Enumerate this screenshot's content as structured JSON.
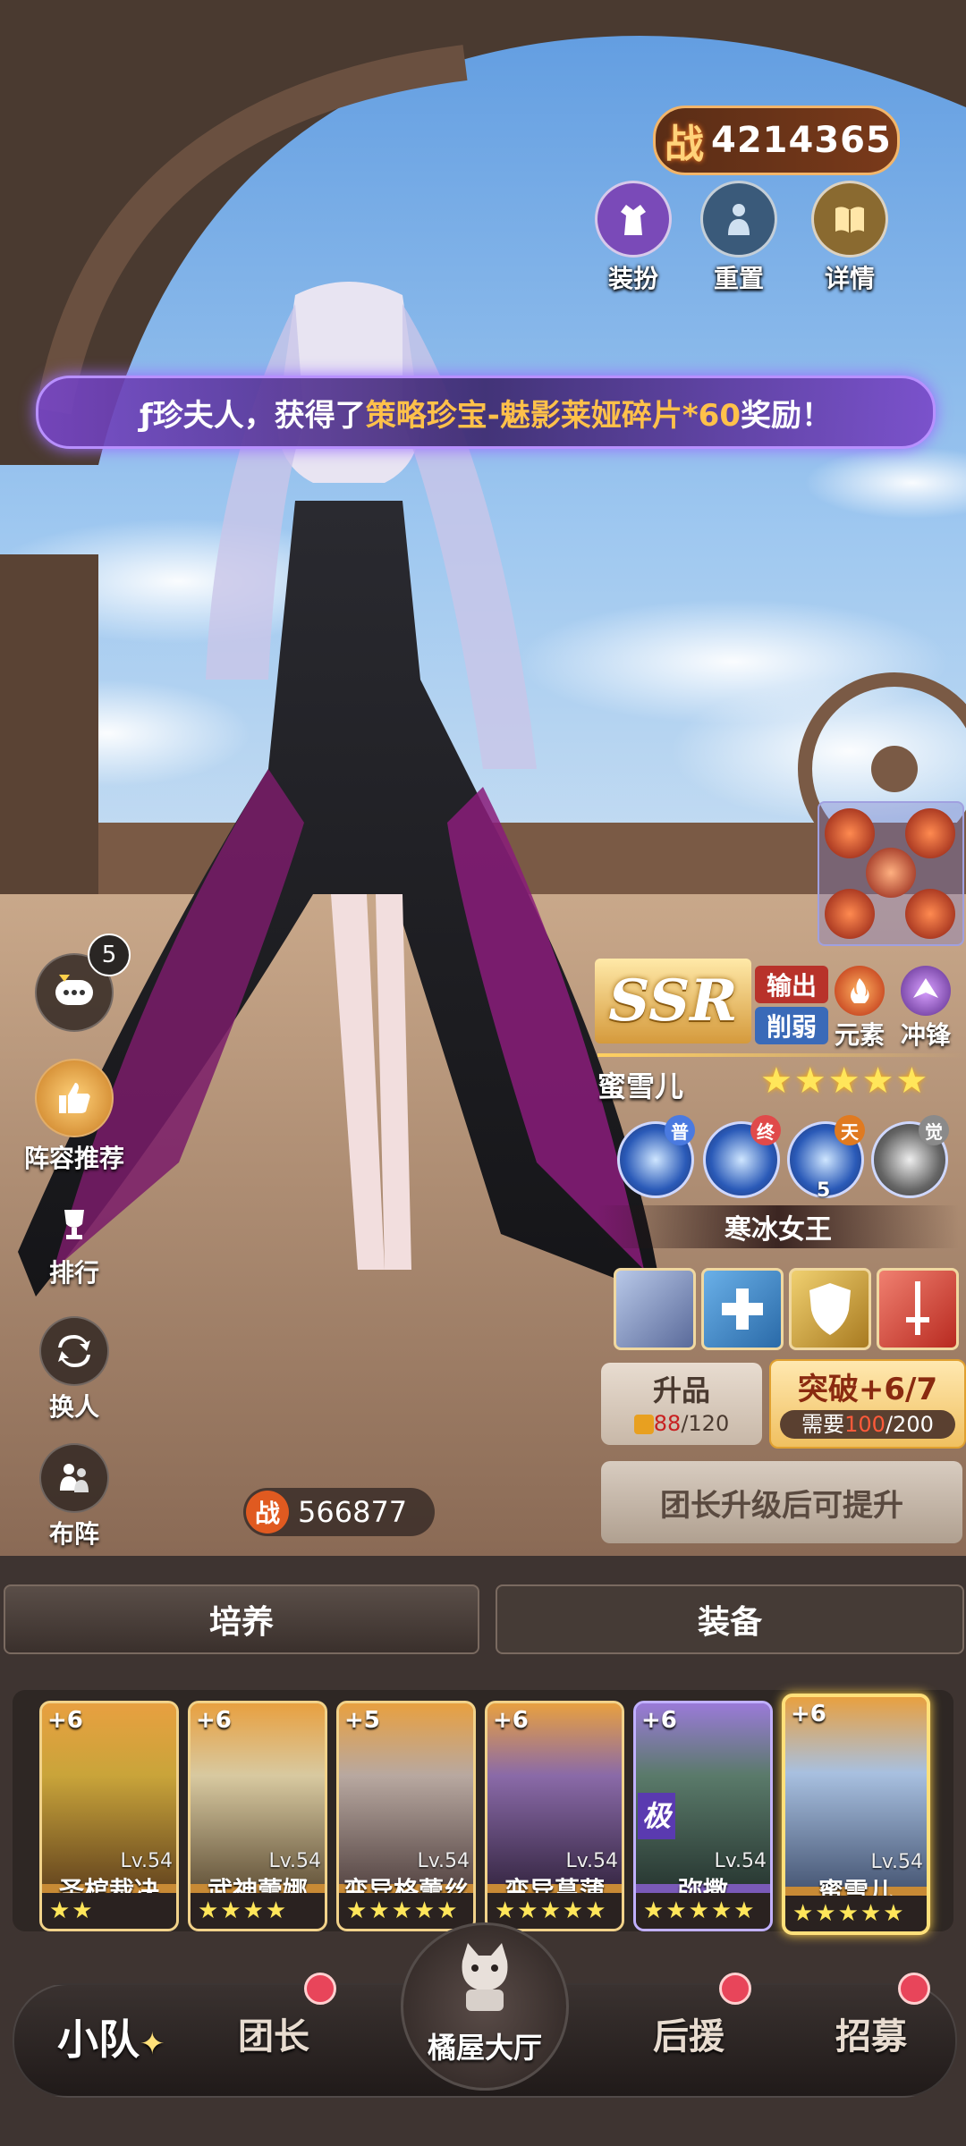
{
  "power": {
    "glyph": "战",
    "total": "4214365"
  },
  "top_buttons": [
    {
      "id": "outfit",
      "label": "装扮",
      "icon": "dress-icon",
      "color": "#7a4ab8"
    },
    {
      "id": "reset",
      "label": "重置",
      "icon": "person-reset-icon",
      "color": "#3a5a7a"
    },
    {
      "id": "details",
      "label": "详情",
      "icon": "book-icon",
      "color": "#8a6a30"
    }
  ],
  "banner": {
    "prefix": "ƒ珍夫人，获得了",
    "highlight": "策略珍宝-魅影莱娅碎片*60",
    "suffix": "奖励！"
  },
  "side_menu": {
    "chat_badge": "5",
    "items": [
      {
        "id": "lineup-recommend",
        "label": "阵容推荐",
        "icon": "thumbs-up-icon"
      },
      {
        "id": "ranking",
        "label": "排行",
        "icon": "trophy-icon"
      },
      {
        "id": "swap",
        "label": "换人",
        "icon": "swap-icon"
      },
      {
        "id": "formation",
        "label": "布阵",
        "icon": "formation-icon"
      }
    ]
  },
  "hero": {
    "rarity": "SSR",
    "role_tags": [
      "输出",
      "削弱"
    ],
    "element_label": "元素",
    "class_label": "冲锋",
    "name": "蜜雪儿",
    "stars": "★★★★★",
    "skills": [
      {
        "tag": "普",
        "tag_color": "#4a7ae0"
      },
      {
        "tag": "终",
        "tag_color": "#e04a4a"
      },
      {
        "tag": "天",
        "tag_color": "#e07a20",
        "level": "5"
      },
      {
        "tag": "觉",
        "tag_color": "#8a8a8a"
      }
    ],
    "title": "寒冰女王",
    "hero_power": "566877"
  },
  "actions": {
    "upgrade": {
      "label": "升品",
      "current": "88",
      "sep": "/",
      "max": "120"
    },
    "breakthrough": {
      "label": "突破+6/7",
      "need_label": "需要",
      "current": "100",
      "sep": "/",
      "max": "200"
    },
    "locked": {
      "label": "团长升级后可提升"
    }
  },
  "main_tabs": {
    "train": "培养",
    "equip": "装备"
  },
  "roster": [
    {
      "plus": "+6",
      "level": "Lv.54",
      "name": "圣棺裁决",
      "stars": "★★",
      "color": "#c9a43a"
    },
    {
      "plus": "+6",
      "level": "Lv.54",
      "name": "武神蕾娜",
      "stars": "★★★★",
      "color": "#d8c9a0"
    },
    {
      "plus": "+5",
      "level": "Lv.54",
      "name": "变异格蕾丝",
      "stars": "★★★★★",
      "color": "#b8a8a0"
    },
    {
      "plus": "+6",
      "level": "Lv.54",
      "name": "变异菖蒲",
      "stars": "★★★★★",
      "color": "#8a6aa8"
    },
    {
      "plus": "+6",
      "level": "Lv.54",
      "name": "弥撒",
      "stars": "★★★★★",
      "color": "#5a7a6a",
      "badge": "极"
    },
    {
      "plus": "+6",
      "level": "Lv.54",
      "name": "蜜雪儿",
      "stars": "★★★★★",
      "color": "#a8c0e0",
      "selected": true
    }
  ],
  "bottom_nav": [
    {
      "id": "squad",
      "label": "小队",
      "active": true
    },
    {
      "id": "leader",
      "label": "团长",
      "dot": true
    },
    {
      "id": "hall",
      "label": "橘屋大厅"
    },
    {
      "id": "support",
      "label": "后援",
      "dot": true
    },
    {
      "id": "recruit",
      "label": "招募",
      "dot": true
    }
  ]
}
